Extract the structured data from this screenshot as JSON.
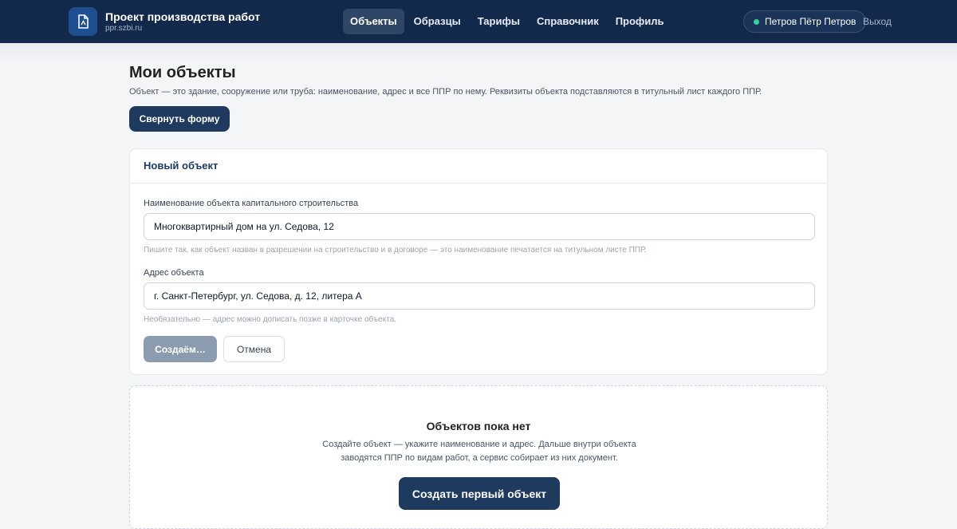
{
  "header": {
    "title": "Проект производства работ",
    "domain": "ppr.szbi.ru",
    "nav": [
      "Объекты",
      "Образцы",
      "Тарифы",
      "Справочник",
      "Профиль"
    ],
    "active_nav": "Объекты",
    "user_name": "Петров Пётр Петров",
    "logout": "Выход"
  },
  "page": {
    "title": "Мои объекты",
    "description": "Объект — это здание, сооружение или труба: наименование, адрес и все ППР по нему. Реквизиты объекта подставляются в титульный лист каждого ППР.",
    "collapse_button": "Свернуть форму"
  },
  "form": {
    "title": "Новый объект",
    "name_label": "Наименование объекта капитального строительства",
    "name_value": "Многоквартирный дом на ул. Седова, 12",
    "name_hint": "Пишите так, как объект назван в разрешении на строительство и в договоре — это наименование печатается на титульном листе ППР.",
    "address_label": "Адрес объекта",
    "address_value": "г. Санкт-Петербург, ул. Седова, д. 12, литера А",
    "address_hint": "Необязательно — адрес можно дописать позже в карточке объекта.",
    "submit_label": "Создаём…",
    "cancel_label": "Отмена"
  },
  "empty_state": {
    "title": "Объектов пока нет",
    "line1": "Создайте объект — укажите наименование и адрес. Дальше внутри объекта",
    "line2": "заводятся ППР по видам работ, а сервис собирает из них документ.",
    "button": "Создать первый объект"
  },
  "colors": {
    "header_bg": "#13294b",
    "primary": "#1e3a5f",
    "status_online": "#34d399",
    "disabled": "#8c9cb0"
  },
  "icons": {
    "logo": "document-icon"
  }
}
